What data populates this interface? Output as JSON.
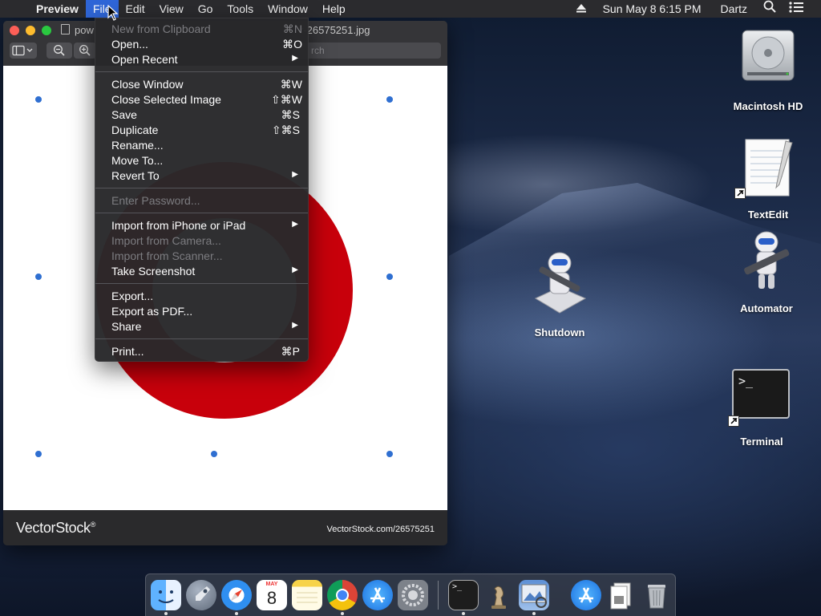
{
  "menubar": {
    "apple_glyph": "",
    "app_name": "Preview",
    "menus": [
      "File",
      "Edit",
      "View",
      "Go",
      "Tools",
      "Window",
      "Help"
    ],
    "clock": "Sun May 8  6:15 PM",
    "user": "Dartz"
  },
  "window": {
    "title_left": "pow",
    "title_right": "r-26575251.jpg",
    "search_placeholder": "rch",
    "footer_brand": "VectorStock",
    "footer_trademark": "®",
    "footer_url": "VectorStock.com/26575251"
  },
  "file_menu": {
    "items": [
      {
        "label": "New from Clipboard",
        "shortcut": "⌘N",
        "enabled": false
      },
      {
        "label": "Open...",
        "shortcut": "⌘O",
        "enabled": true
      },
      {
        "label": "Open Recent",
        "submenu": true,
        "enabled": true
      },
      {
        "label": "Close Window",
        "shortcut": "⌘W",
        "enabled": true
      },
      {
        "label": "Close Selected Image",
        "shortcut": "⇧⌘W",
        "enabled": true
      },
      {
        "label": "Save",
        "shortcut": "⌘S",
        "enabled": true
      },
      {
        "label": "Duplicate",
        "shortcut": "⇧⌘S",
        "enabled": true
      },
      {
        "label": "Rename...",
        "enabled": true
      },
      {
        "label": "Move To...",
        "enabled": true
      },
      {
        "label": "Revert To",
        "submenu": true,
        "enabled": true
      },
      {
        "label": "Enter Password...",
        "enabled": false
      },
      {
        "label": "Import from iPhone or iPad",
        "submenu": true,
        "enabled": true
      },
      {
        "label": "Import from Camera...",
        "enabled": false
      },
      {
        "label": "Import from Scanner...",
        "enabled": false
      },
      {
        "label": "Take Screenshot",
        "submenu": true,
        "enabled": true
      },
      {
        "label": "Export...",
        "enabled": true
      },
      {
        "label": "Export as PDF...",
        "enabled": true
      },
      {
        "label": "Share",
        "submenu": true,
        "enabled": true
      },
      {
        "label": "Print...",
        "shortcut": "⌘P",
        "enabled": true
      }
    ]
  },
  "desktop": {
    "icons": [
      "Macintosh HD",
      "TextEdit",
      "Shutdown",
      "Automator",
      "Terminal"
    ]
  },
  "dock": {
    "calendar_month": "MAY",
    "calendar_day": "8",
    "terminal_prompt": ">_"
  },
  "colors": {
    "menubar_bg": "#2b2b2e",
    "menu_highlight": "#2f66d8",
    "ring_red": "#c8000b",
    "selection_handle": "#2f6fd1"
  }
}
